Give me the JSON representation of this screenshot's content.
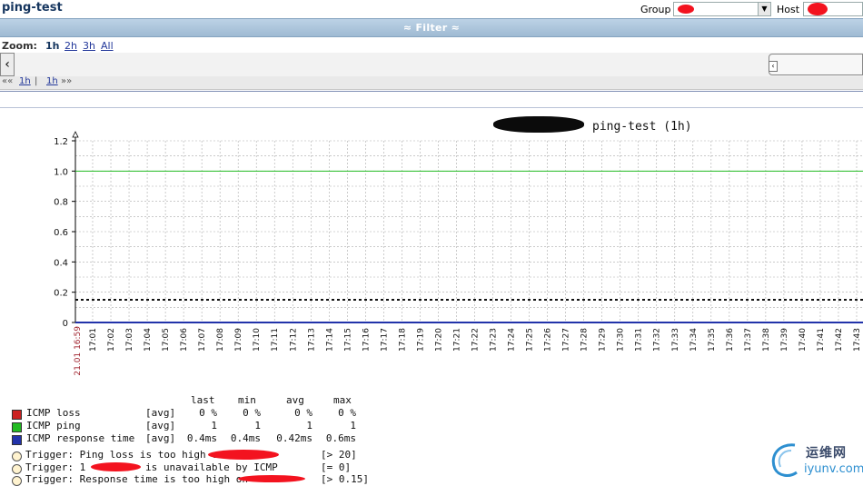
{
  "header": {
    "title": "ping-test",
    "group_label": "Group",
    "host_label": "Host"
  },
  "filter": {
    "label": "≈ Filter ≈"
  },
  "zoom": {
    "label": "Zoom:",
    "options": [
      "1h",
      "2h",
      "3h",
      "All"
    ],
    "active": "1h"
  },
  "period": {
    "prev": "««",
    "left_link": "1h",
    "sep": "|",
    "right_link": "1h",
    "next": "»»"
  },
  "icons": {
    "nav_left": "‹",
    "slider_grip": "‹",
    "select_arrow": "▼"
  },
  "chart_data": {
    "type": "line",
    "title": "ping-test (1h)",
    "ylim": [
      0,
      1.2
    ],
    "yticks": [
      "0",
      "0.2",
      "0.4",
      "0.6",
      "0.8",
      "1.0",
      "1.2"
    ],
    "start_label": "21.01 16:59",
    "xticks": [
      "17:01",
      "17:02",
      "17:03",
      "17:04",
      "17:05",
      "17:06",
      "17:07",
      "17:08",
      "17:09",
      "17:10",
      "17:11",
      "17:12",
      "17:13",
      "17:14",
      "17:15",
      "17:16",
      "17:17",
      "17:18",
      "17:19",
      "17:20",
      "17:21",
      "17:22",
      "17:23",
      "17:24",
      "17:25",
      "17:26",
      "17:27",
      "17:28",
      "17:29",
      "17:30",
      "17:31",
      "17:32",
      "17:33",
      "17:34",
      "17:35",
      "17:36",
      "17:37",
      "17:38",
      "17:39",
      "17:40",
      "17:41",
      "17:42",
      "17:43"
    ],
    "grid": true,
    "series": [
      {
        "name": "ICMP loss",
        "color": "#cc2222",
        "value": 0
      },
      {
        "name": "ICMP ping",
        "color": "#22bb22",
        "value": 1
      },
      {
        "name": "ICMP response time",
        "color": "#2233aa",
        "value": 0
      }
    ],
    "trigger_line": {
      "value": 0.15,
      "color": "#111111"
    },
    "legend_headers": {
      "last": "last",
      "min": "min",
      "avg": "avg",
      "max": "max"
    },
    "legend_rows": [
      {
        "name": "ICMP loss",
        "func": "[avg]",
        "last": "0 %",
        "min": "0 %",
        "avg": "0 %",
        "max": "0 %",
        "color": "#cc2222"
      },
      {
        "name": "ICMP ping",
        "func": "[avg]",
        "last": "1",
        "min": "1",
        "avg": "1",
        "max": "1",
        "color": "#22bb22"
      },
      {
        "name": "ICMP response time",
        "func": "[avg]",
        "last": "0.4ms",
        "min": "0.4ms",
        "avg": "0.42ms",
        "max": "0.6ms",
        "color": "#2233aa"
      }
    ],
    "triggers": [
      {
        "text_a": "Trigger: Ping loss is too high on",
        "cond": "[> 20]"
      },
      {
        "text_a": "Trigger: 1",
        "text_b": "is unavailable by ICMP",
        "cond": "[= 0]"
      },
      {
        "text_a": "Trigger: Response time is too high on",
        "cond": "[> 0.15]"
      }
    ]
  },
  "watermark": {
    "cn": "运维网",
    "en": "iyunv.com"
  }
}
